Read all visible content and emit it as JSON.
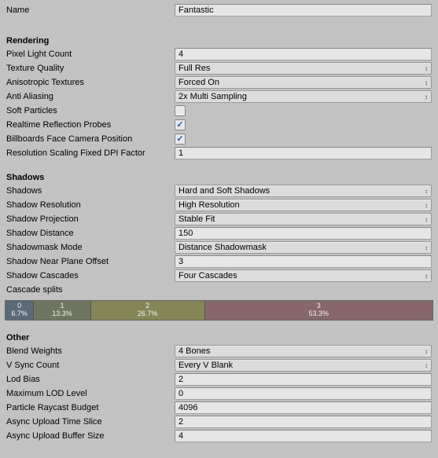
{
  "name": {
    "label": "Name",
    "value": "Fantastic"
  },
  "sections": {
    "rendering": {
      "title": "Rendering"
    },
    "shadows": {
      "title": "Shadows"
    },
    "other": {
      "title": "Other"
    }
  },
  "rendering": {
    "pixel_light_count": {
      "label": "Pixel Light Count",
      "value": "4"
    },
    "texture_quality": {
      "label": "Texture Quality",
      "value": "Full Res"
    },
    "anisotropic_textures": {
      "label": "Anisotropic Textures",
      "value": "Forced On"
    },
    "anti_aliasing": {
      "label": "Anti Aliasing",
      "value": "2x Multi Sampling"
    },
    "soft_particles": {
      "label": "Soft Particles",
      "checked": false
    },
    "realtime_reflection_probes": {
      "label": "Realtime Reflection Probes",
      "checked": true
    },
    "billboards_face_camera": {
      "label": "Billboards Face Camera Position",
      "checked": true
    },
    "resolution_scaling_dpi": {
      "label": "Resolution Scaling Fixed DPI Factor",
      "value": "1"
    }
  },
  "shadows": {
    "shadows": {
      "label": "Shadows",
      "value": "Hard and Soft Shadows"
    },
    "shadow_resolution": {
      "label": "Shadow Resolution",
      "value": "High Resolution"
    },
    "shadow_projection": {
      "label": "Shadow Projection",
      "value": "Stable Fit"
    },
    "shadow_distance": {
      "label": "Shadow Distance",
      "value": "150"
    },
    "shadowmask_mode": {
      "label": "Shadowmask Mode",
      "value": "Distance Shadowmask"
    },
    "shadow_near_plane": {
      "label": "Shadow Near Plane Offset",
      "value": "3"
    },
    "shadow_cascades": {
      "label": "Shadow Cascades",
      "value": "Four Cascades"
    },
    "cascade_splits": {
      "label": "Cascade splits"
    },
    "cascade_segments": [
      {
        "index": "0",
        "percent": "6.7%",
        "width": 6.7
      },
      {
        "index": "1",
        "percent": "13.3%",
        "width": 13.3
      },
      {
        "index": "2",
        "percent": "26.7%",
        "width": 26.7
      },
      {
        "index": "3",
        "percent": "53.3%",
        "width": 53.3
      }
    ]
  },
  "other": {
    "blend_weights": {
      "label": "Blend Weights",
      "value": "4 Bones"
    },
    "vsync_count": {
      "label": "V Sync Count",
      "value": "Every V Blank"
    },
    "lod_bias": {
      "label": "Lod Bias",
      "value": "2"
    },
    "max_lod_level": {
      "label": "Maximum LOD Level",
      "value": "0"
    },
    "particle_raycast_budget": {
      "label": "Particle Raycast Budget",
      "value": "4096"
    },
    "async_upload_time_slice": {
      "label": "Async Upload Time Slice",
      "value": "2"
    },
    "async_upload_buffer_size": {
      "label": "Async Upload Buffer Size",
      "value": "4"
    }
  }
}
